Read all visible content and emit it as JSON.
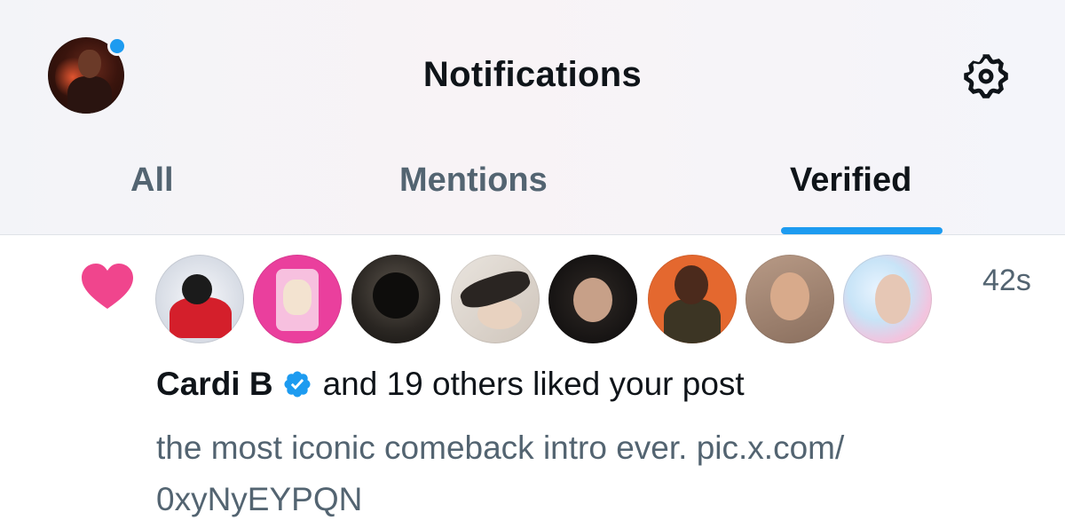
{
  "header": {
    "title": "Notifications",
    "has_unread_dot": true,
    "settings_icon": "gear-icon"
  },
  "tabs": [
    {
      "label": "All",
      "active": false
    },
    {
      "label": "Mentions",
      "active": false
    },
    {
      "label": "Verified",
      "active": true
    }
  ],
  "colors": {
    "accent": "#1d9bf0",
    "like": "#f0458d",
    "text": "#0f1419",
    "secondary": "#536471"
  },
  "notification": {
    "type_icon": "heart-icon",
    "time": "42s",
    "avatar_count": 8,
    "actor": "Cardi B",
    "actor_verified": true,
    "action_text": "and 19 others liked your post",
    "post_text": "the most iconic comeback intro ever. pic.x.com/ 0xyNyEYPQN"
  }
}
